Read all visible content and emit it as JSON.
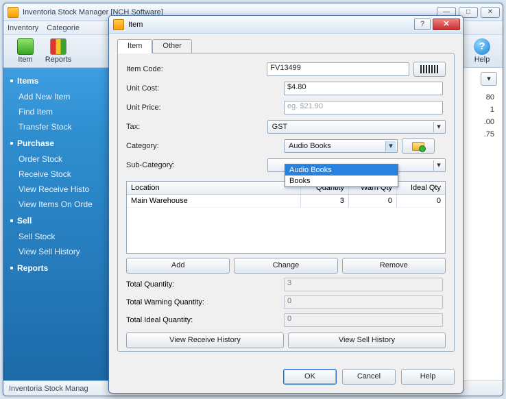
{
  "app": {
    "title": "Inventoria Stock Manager [NCH Software]"
  },
  "menubar": {
    "items": [
      "Inventory",
      "Categorie"
    ]
  },
  "toolbar": {
    "item_label": "Item",
    "reports_label": "Reports",
    "help_label": "Help"
  },
  "sidebar": {
    "groups": [
      {
        "title": "Items",
        "items": [
          "Add New Item",
          "Find Item",
          "Transfer Stock"
        ]
      },
      {
        "title": "Purchase",
        "items": [
          "Order Stock",
          "Receive Stock",
          "View Receive Histo",
          "View Items On Orde"
        ]
      },
      {
        "title": "Sell",
        "items": [
          "Sell Stock",
          "View Sell History"
        ]
      },
      {
        "title": "Reports",
        "items": []
      }
    ]
  },
  "content_peek": {
    "values": [
      "80",
      "1",
      ".00",
      ".75"
    ]
  },
  "statusbar": {
    "text": "Inventoria Stock Manag"
  },
  "dialog": {
    "title": "Item",
    "tabs": [
      "Item",
      "Other"
    ],
    "labels": {
      "item_code": "Item Code:",
      "unit_cost": "Unit Cost:",
      "unit_price": "Unit Price:",
      "tax": "Tax:",
      "category": "Category:",
      "sub_category": "Sub-Category:"
    },
    "values": {
      "item_code": "FV13499",
      "unit_cost": "$4.80",
      "unit_price_placeholder": "eg. $21.90",
      "tax": "GST",
      "category": "Audio Books",
      "sub_category": ""
    },
    "category_options": [
      "Audio Books",
      "Books"
    ],
    "table": {
      "headers": {
        "location": "Location",
        "quantity": "Quantity",
        "warn": "Warn Qty",
        "ideal": "Ideal Qty"
      },
      "rows": [
        {
          "location": "Main Warehouse",
          "quantity": "3",
          "warn": "0",
          "ideal": "0"
        }
      ]
    },
    "buttons": {
      "add": "Add",
      "change": "Change",
      "remove": "Remove",
      "view_receive": "View Receive History",
      "view_sell": "View Sell History",
      "ok": "OK",
      "cancel": "Cancel",
      "help": "Help"
    },
    "totals": {
      "qty_label": "Total Quantity:",
      "qty_val": "3",
      "warn_label": "Total Warning Quantity:",
      "warn_val": "0",
      "ideal_label": "Total Ideal Quantity:",
      "ideal_val": "0"
    }
  }
}
